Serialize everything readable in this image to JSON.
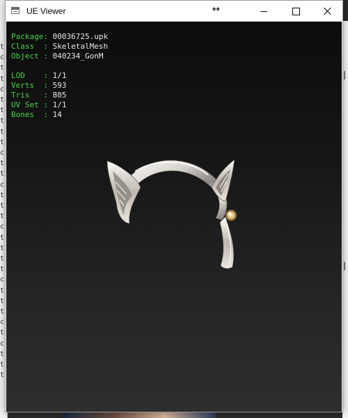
{
  "window": {
    "title": "UE Viewer",
    "resize_icon": "↔",
    "buttons": {
      "minimize": "minimize",
      "maximize": "maximize",
      "close": "close"
    }
  },
  "background_console": {
    "chars": [
      "t",
      "c",
      "t",
      "t",
      "c",
      "t",
      "t",
      "t",
      "t",
      "t",
      "c",
      "t",
      "t",
      "c",
      "t",
      "t",
      "t",
      "c",
      "t",
      "t",
      "t",
      "t",
      "c",
      "t",
      "t",
      "t",
      "c",
      "t",
      "c",
      "t",
      "t",
      "t"
    ]
  },
  "info_block": {
    "package": {
      "key": "Package:",
      "value": "00036725.upk"
    },
    "class": {
      "key": "Class  :",
      "value": "SkeletalMesh"
    },
    "object": {
      "key": "Object :",
      "value": "040234_GonM"
    },
    "lod": {
      "key": "LOD    :",
      "value": "1/1"
    },
    "verts": {
      "key": "Verts  :",
      "value": "593"
    },
    "tris": {
      "key": "Tris   :",
      "value": "805"
    },
    "uvset": {
      "key": "UV Set :",
      "value": "1/1"
    },
    "bones": {
      "key": "Bones  :",
      "value": "14"
    }
  },
  "colors": {
    "key_text": "#4cd04c",
    "value_text": "#e6e6e6",
    "viewport_bg": "#161616"
  }
}
